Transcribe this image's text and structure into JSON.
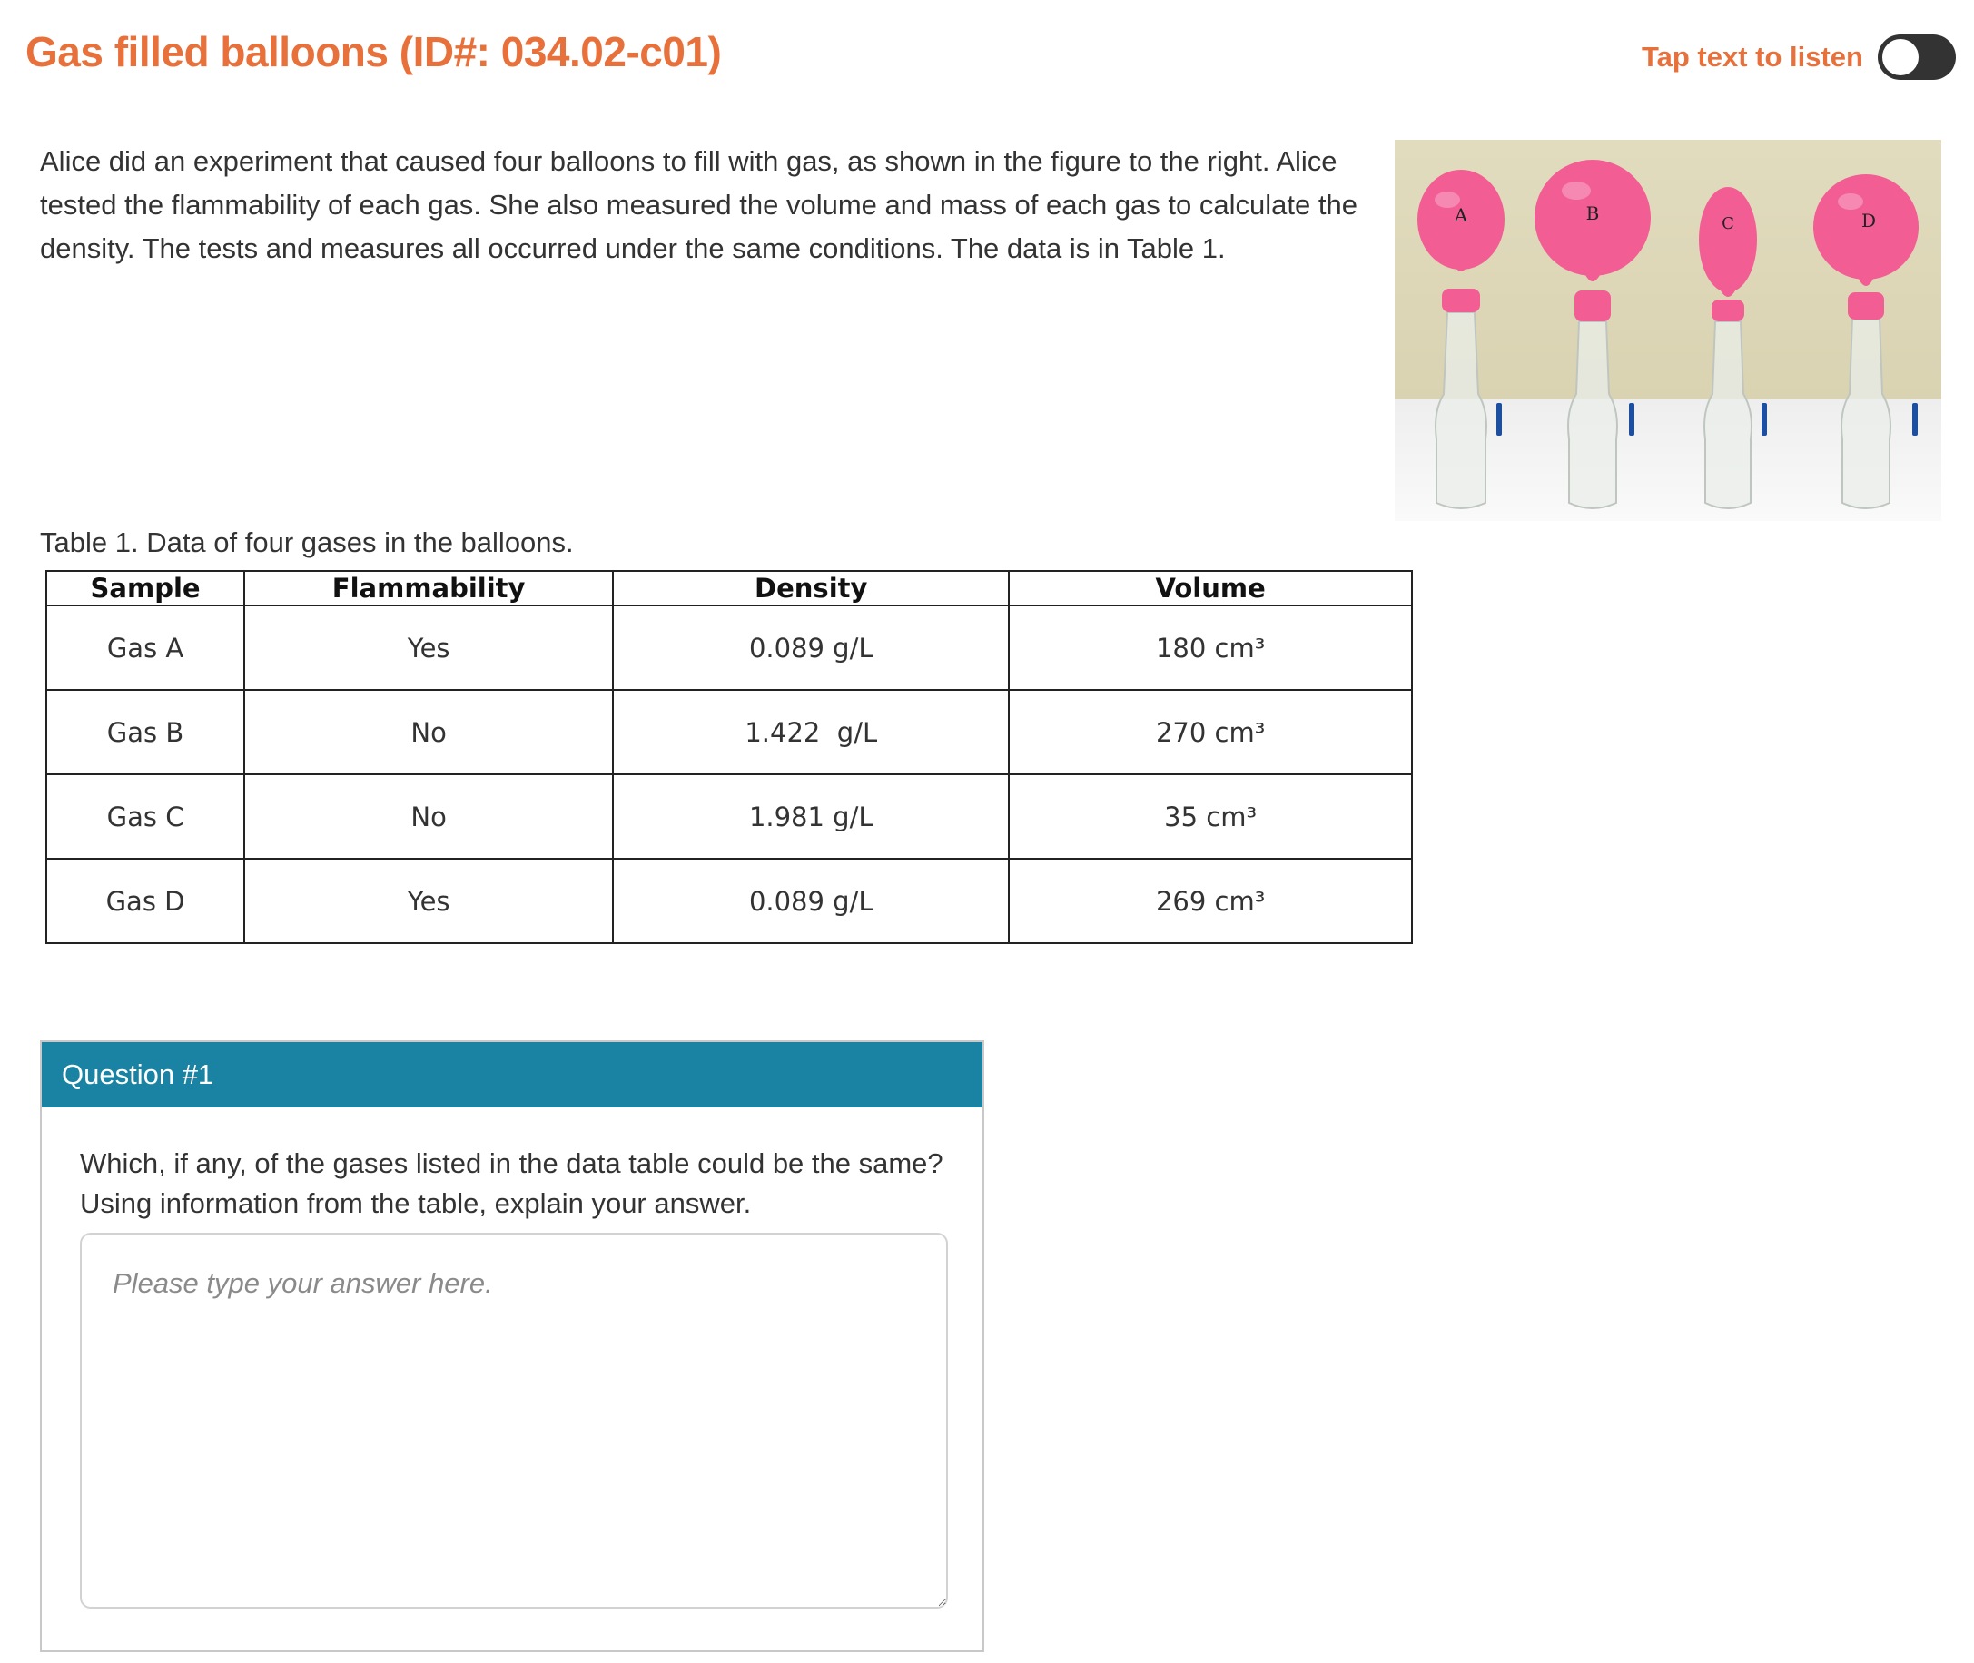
{
  "header": {
    "title": "Gas filled balloons (ID#: 034.02-c01)",
    "listen_label": "Tap text to listen"
  },
  "intro": "Alice did an experiment that caused four balloons to fill with gas, as shown in the figure to the right. Alice tested the flammability of each gas. She also measured the volume and mass of each gas to calculate the density. The tests and measures all occurred under the same conditions. The data is in Table 1.",
  "figure": {
    "balloon_labels": [
      "A",
      "B",
      "C",
      "D"
    ],
    "balloon_color": "#f25d94"
  },
  "table": {
    "caption": "Table 1. Data of four gases in the balloons.",
    "headers": [
      "Sample",
      "Flammability",
      "Density",
      "Volume"
    ],
    "rows": [
      {
        "sample": "Gas A",
        "flammability": "Yes",
        "density": "0.089 g/L",
        "volume": "180 cm³"
      },
      {
        "sample": "Gas B",
        "flammability": "No",
        "density": "1.422  g/L",
        "volume": "270 cm³"
      },
      {
        "sample": "Gas C",
        "flammability": "No",
        "density": "1.981 g/L",
        "volume": "35 cm³"
      },
      {
        "sample": "Gas D",
        "flammability": "Yes",
        "density": "0.089 g/L",
        "volume": "269 cm³"
      }
    ]
  },
  "question": {
    "header": "Question #1",
    "text": "Which, if any, of the gases listed in the data table could be the same? Using information from the table, explain your answer.",
    "placeholder": "Please type your answer here.",
    "value": ""
  },
  "colors": {
    "accent": "#e8703a",
    "question_header": "#1a82a2"
  }
}
